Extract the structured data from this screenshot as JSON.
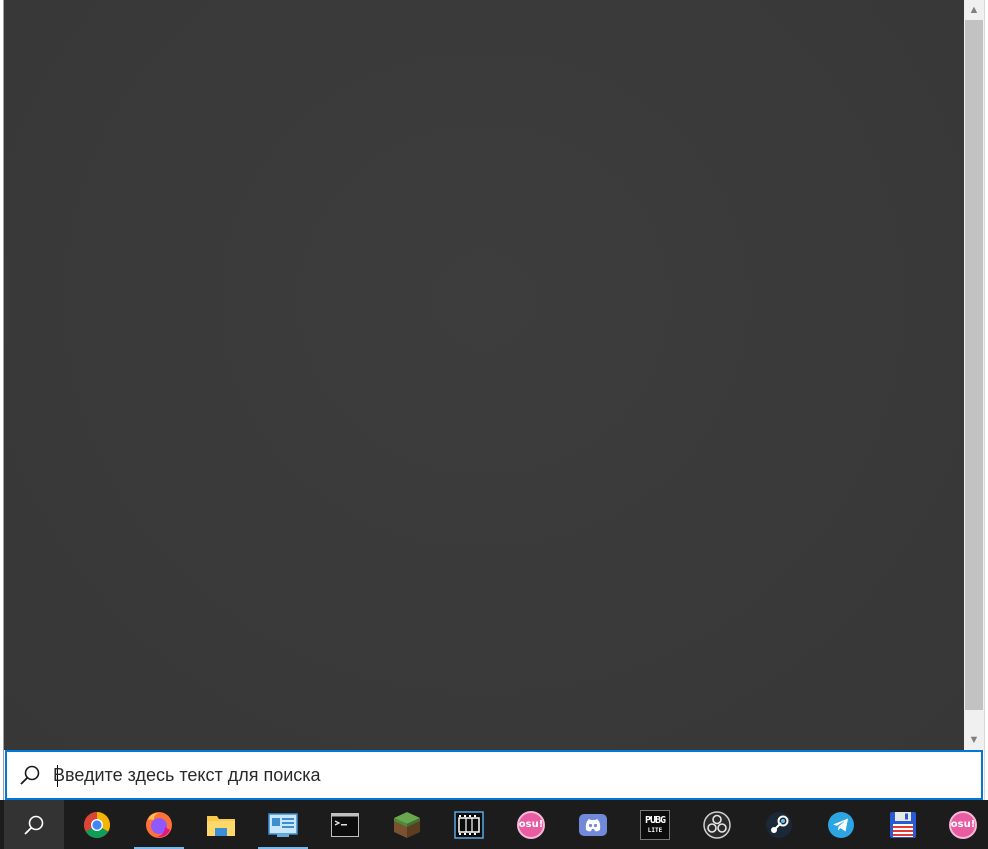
{
  "search": {
    "placeholder": "Введите здесь текст для поиска",
    "value": ""
  },
  "colors": {
    "panel": "#3a3a3a",
    "accent": "#0078d7",
    "taskbar": "#1c1c1c",
    "active_indicator": "#76b9ed"
  },
  "taskbar": {
    "search_button_icon": "search-icon",
    "apps": [
      {
        "name": "Google Chrome",
        "icon": "chrome-icon",
        "active": false
      },
      {
        "name": "Firefox",
        "icon": "firefox-icon",
        "active": true
      },
      {
        "name": "File Explorer",
        "icon": "folder-icon",
        "active": false
      },
      {
        "name": "Control Panel",
        "icon": "control-panel-icon",
        "active": true
      },
      {
        "name": "Command Prompt",
        "icon": "terminal-icon",
        "active": false
      },
      {
        "name": "Minecraft",
        "icon": "minecraft-icon",
        "active": false
      },
      {
        "name": "Video Editor",
        "icon": "film-icon",
        "active": false
      },
      {
        "name": "osu!",
        "icon": "osu-icon",
        "label": "osu!",
        "active": false
      },
      {
        "name": "Discord",
        "icon": "discord-icon",
        "active": false
      },
      {
        "name": "PUBG Lite",
        "icon": "pubg-icon",
        "label": "PUBG",
        "sublabel": "LITE",
        "active": false
      },
      {
        "name": "OBS Studio",
        "icon": "obs-icon",
        "active": false
      },
      {
        "name": "Steam",
        "icon": "steam-icon",
        "active": false
      },
      {
        "name": "Telegram",
        "icon": "telegram-icon",
        "active": false
      },
      {
        "name": "Save",
        "icon": "floppy-disk-icon",
        "active": false
      },
      {
        "name": "osu!",
        "icon": "osu-icon",
        "label": "osu!",
        "active": false
      }
    ]
  }
}
